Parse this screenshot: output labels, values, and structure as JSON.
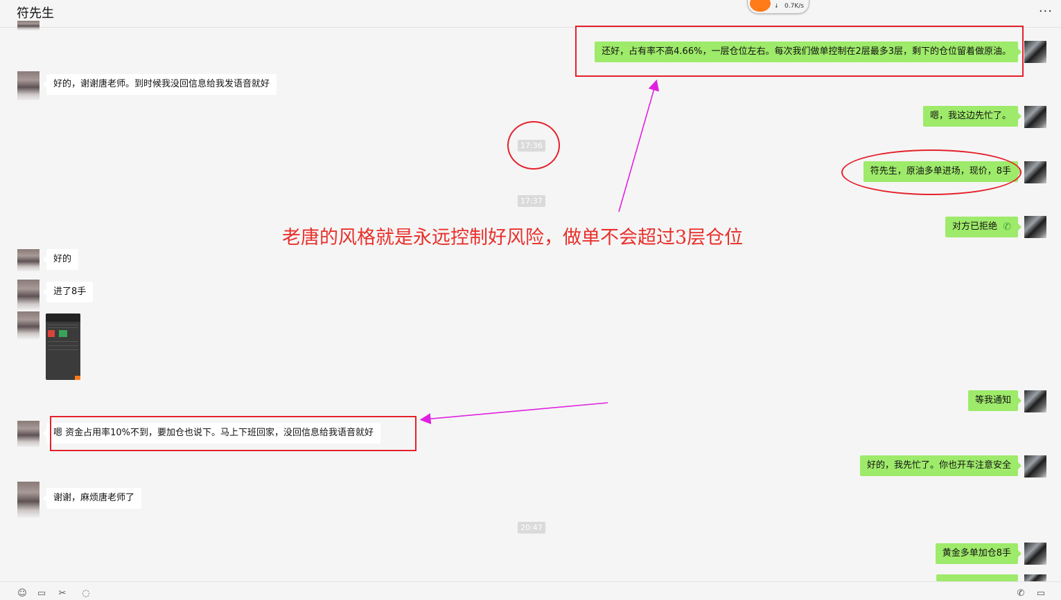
{
  "header": {
    "title": "符先生",
    "more": "···",
    "net_speed": "0.7K/s",
    "net_arrow": "↓"
  },
  "messages": {
    "m1": "还好，占有率不高4.66%，一层仓位左右。每次我们做单控制在2层最多3层，剩下的仓位留着做原油。",
    "m2": "好的，谢谢唐老师。到时候我没回信息给我发语音就好",
    "m3": "嗯，我这边先忙了。",
    "m4": "符先生，原油多单进场，现价，8手",
    "m5": "对方已拒绝",
    "m6": "好的",
    "m7": "进了8手",
    "m8": "等我通知",
    "m9": "嗯 资金占用率10%不到，要加仓也说下。马上下班回家，没回信息给我语音就好",
    "m10": "好的，我先忙了。你也开车注意安全",
    "m11": "谢谢，麻烦唐老师了",
    "m12": "黄金多单加仓8手"
  },
  "times": {
    "t1": "17:36",
    "t2": "17:37",
    "t3": "20:47"
  },
  "annotation": "老唐的风格就是永远控制好风险，做单不会超过3层仓位",
  "colors": {
    "accent_red": "#e5202a",
    "arrow_magenta": "#e020e0",
    "bubble_green": "#9eea6a"
  },
  "icons": [
    "emoji-icon",
    "folder-icon",
    "scissors-icon",
    "chat-icon",
    "phone-icon",
    "video-icon",
    "call-icon"
  ]
}
